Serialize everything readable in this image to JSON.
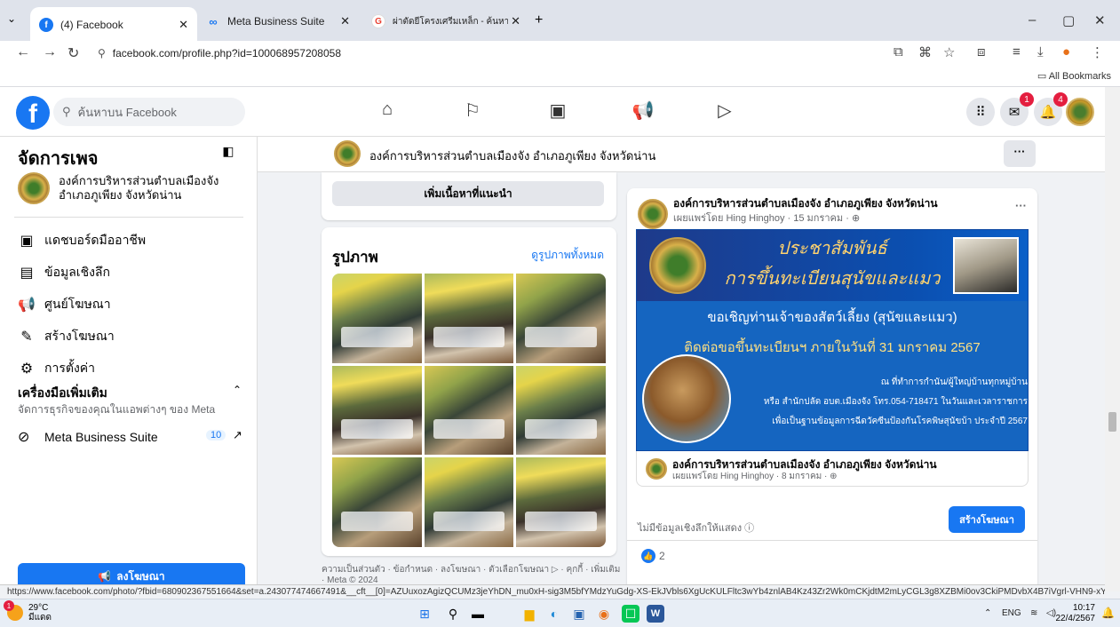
{
  "browser": {
    "tabs": [
      {
        "title": "(4) Facebook",
        "active": true
      },
      {
        "title": "Meta Business Suite",
        "active": false
      },
      {
        "title": "ผ่าตัดยีโครงเศรีมเหล็ก - ค้นหาด้วย G",
        "active": false
      }
    ],
    "url": "facebook.com/profile.php?id=100068957208058",
    "bookmarks_label": "All Bookmarks",
    "status_url": "https://www.facebook.com/photo/?fbid=680902367551664&set=a.243077474667491&__cft__[0]=AZUuxozAgizQCUMz3jeYhDN_mu0xH-sig3M5bfYMdzYuGdg-XS-EkJVbls6XgUcKULFltc3wYb4znlAB4Kz43Zr2Wk0mCKjdtM2mLyCGL3g8XZBMi0ov3CkiPMDvbX4B7iVgrl-VHN9-xYRUG0O7WhFhWP..."
  },
  "fb": {
    "search_placeholder": "ค้นหาบน Facebook",
    "messenger_badge": "1",
    "notif_badge": "4"
  },
  "sidebar": {
    "title": "จัดการเพจ",
    "page_name": "องค์การบริหารส่วนตำบลเมืองจัง อำเภอภูเพียง จังหวัดน่าน",
    "items": [
      {
        "label": "แดชบอร์ดมืออาชีพ",
        "icon": "dashboard-icon"
      },
      {
        "label": "ข้อมูลเชิงลึก",
        "icon": "insights-icon"
      },
      {
        "label": "ศูนย์โฆษณา",
        "icon": "megaphone-icon"
      },
      {
        "label": "สร้างโฆษณา",
        "icon": "pencil-icon"
      },
      {
        "label": "การตั้งค่า",
        "icon": "gear-icon"
      }
    ],
    "tools_heading": "เครื่องมือเพิ่มเติม",
    "tools_sub": "จัดการธุรกิจของคุณในแอพต่างๆ ของ Meta",
    "meta_suite_label": "Meta Business Suite",
    "meta_suite_count": "10",
    "advertise_label": "ลงโฆษณา"
  },
  "page_header": {
    "name": "องค์การบริหารส่วนตำบลเมืองจัง อำเภอภูเพียง จังหวัดน่าน"
  },
  "left_col": {
    "recommend_btn": "เพิ่มเนื้อหาที่แนะนำ",
    "photos_title": "รูปภาพ",
    "photos_link": "ดูรูปภาพทั้งหมด",
    "footer": "ความเป็นส่วนตัว · ข้อกำหนด · ลงโฆษณา · ตัวเลือกโฆษณา ▷ · คุกกี้ · เพิ่มเติม · Meta © 2024"
  },
  "post": {
    "author": "องค์การบริหารส่วนตำบลเมืองจัง อำเภอภูเพียง จังหวัดน่าน",
    "meta": "เผยแพร่โดย Hing Hinghoy · 15 มกราคม ·",
    "poster": {
      "title1": "ประชาสัมพันธ์",
      "title2": "การขึ้นทะเบียนสุนัขและแมว",
      "line1": "ขอเชิญท่านเจ้าของสัตว์เลี้ยง (สุนัขและแมว)",
      "line2": "ติดต่อขอขึ้นทะเบียนฯ ภายในวันที่ 31 มกราคม 2567",
      "line3": "ณ ที่ทำการกำนัน/ผู้ใหญ่บ้านทุกหมู่บ้าน",
      "line4": "หรือ สำนักปลัด อบต.เมืองจัง โทร.054-718471 ในวันและเวลาราชการ",
      "line5": "เพื่อเป็นฐานข้อมูลการฉีดวัคซีนป้องกันโรคพิษสุนัขบ้า ประจำปี 2567"
    },
    "shared_author": "องค์การบริหารส่วนตำบลเมืองจัง อำเภอภูเพียง จังหวัดน่าน",
    "shared_meta": "เผยแพร่โดย Hing Hinghoy · 8 มกราคม ·",
    "insight_text": "ไม่มีข้อมูลเชิงลึกให้แสดง",
    "boost_label": "สร้างโฆษณา",
    "likes": "2"
  },
  "taskbar": {
    "temp": "29°C",
    "weather": "มีแดด",
    "weather_badge": "1",
    "lang": "ENG",
    "time": "10:17",
    "date": "22/4/2567"
  }
}
